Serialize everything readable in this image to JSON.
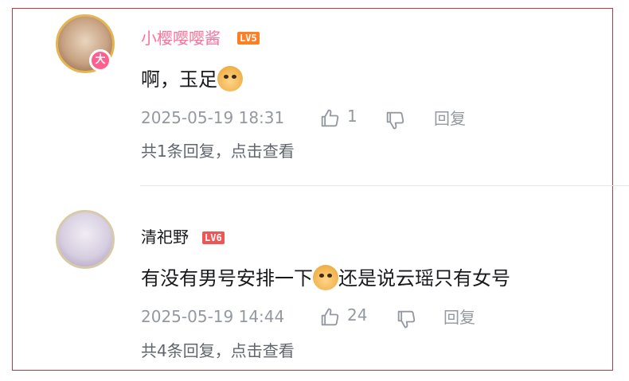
{
  "comments": [
    {
      "username": "小樱嘤嘤酱",
      "level": "LV5",
      "avatar_badge": "大",
      "text": "啊，玉足",
      "emoji": "doge-emoji",
      "timestamp": "2025-05-19 18:31",
      "like_count": "1",
      "reply_label": "回复",
      "replies_link": "共1条回复，点击查看"
    },
    {
      "username": "清祀野",
      "level": "LV6",
      "text_before_emoji": "有没有男号安排一下",
      "emoji": "doge-emoji",
      "text_after_emoji": "还是说云瑶只有女号",
      "timestamp": "2025-05-19 14:44",
      "like_count": "24",
      "reply_label": "回复",
      "replies_link": "共4条回复，点击查看"
    }
  ],
  "colors": {
    "vip_name": "#fb7299",
    "normal_name": "#18191c",
    "meta": "#9499a0",
    "lv5": "#ff7f24",
    "lv6": "#ee5656",
    "frame_border": "#c9343a"
  }
}
